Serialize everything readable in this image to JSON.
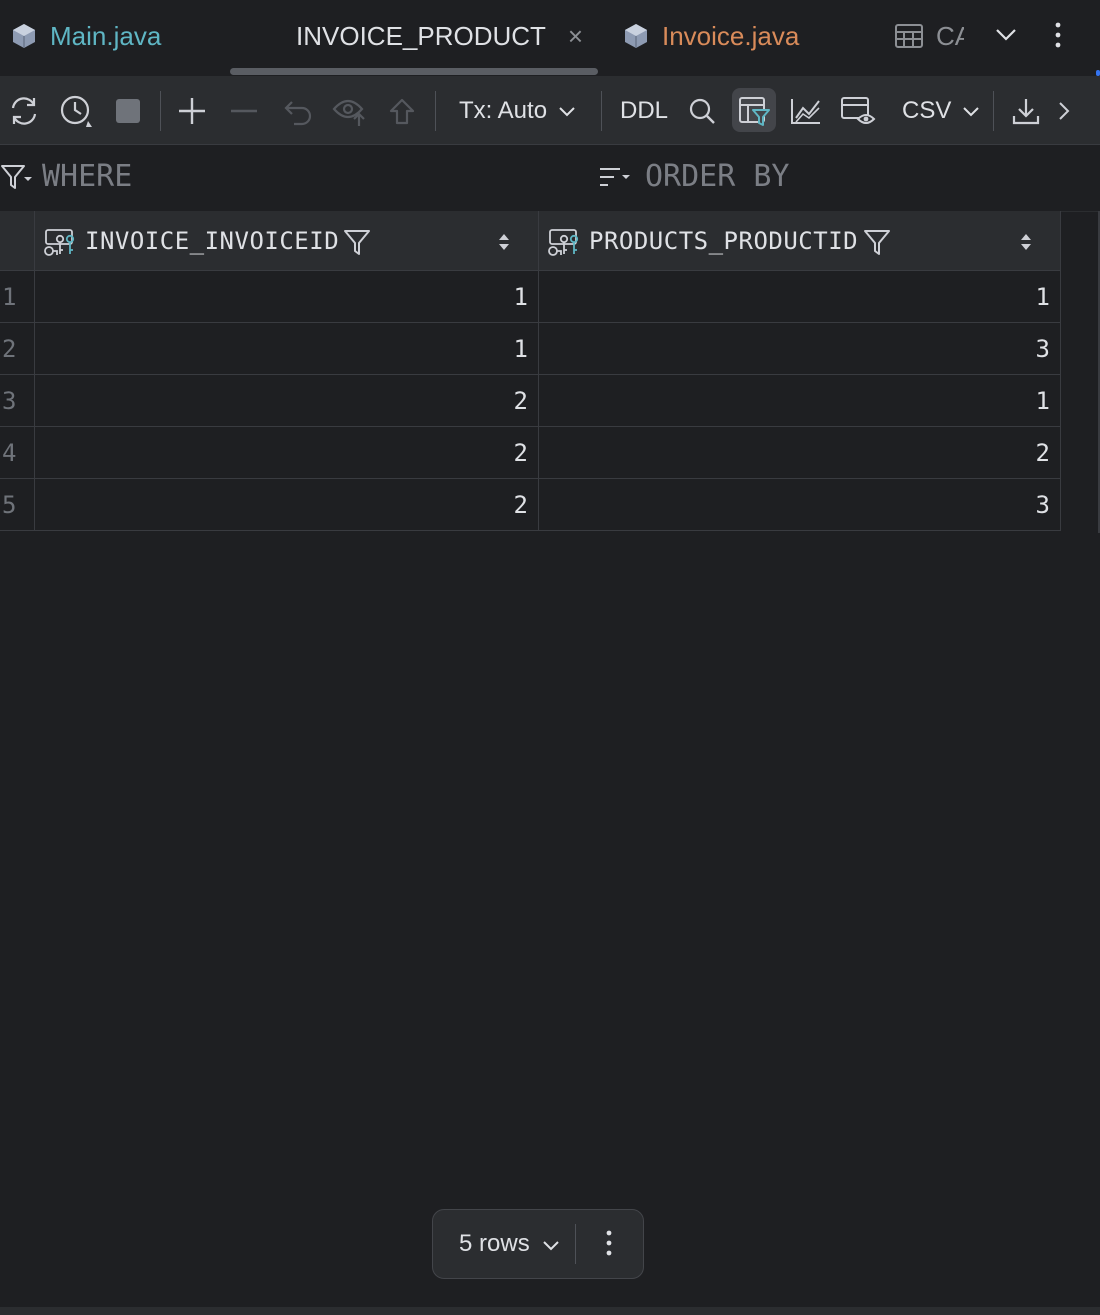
{
  "tabs": [
    {
      "label": "Main.java",
      "icon": "java-class-icon",
      "color": "#5fb6c4"
    },
    {
      "label": "INVOICE_PRODUCT",
      "icon": "none",
      "close": "×"
    },
    {
      "label": "Invoice.java",
      "icon": "java-class-icon",
      "color": "#d98b5a"
    },
    {
      "label": "CA",
      "icon": "table-icon"
    }
  ],
  "toolbar": {
    "tx_label": "Tx: Auto",
    "ddl_label": "DDL",
    "format_label": "CSV"
  },
  "filter": {
    "where_label": "WHERE",
    "order_label": "ORDER BY"
  },
  "table": {
    "columns": [
      "INVOICE_INVOICEID",
      "PRODUCTS_PRODUCTID"
    ],
    "rows": [
      {
        "num": "1",
        "c1": "1",
        "c2": "1"
      },
      {
        "num": "2",
        "c1": "1",
        "c2": "3"
      },
      {
        "num": "3",
        "c1": "2",
        "c2": "1"
      },
      {
        "num": "4",
        "c1": "2",
        "c2": "2"
      },
      {
        "num": "5",
        "c1": "2",
        "c2": "3"
      }
    ]
  },
  "footer": {
    "row_count": "5 rows"
  },
  "colors": {
    "background": "#1e1f22",
    "toolbar": "#2b2d30",
    "accent": "#3574f0",
    "java_teal": "#5fb6c4",
    "java_orange": "#d98b5a"
  }
}
